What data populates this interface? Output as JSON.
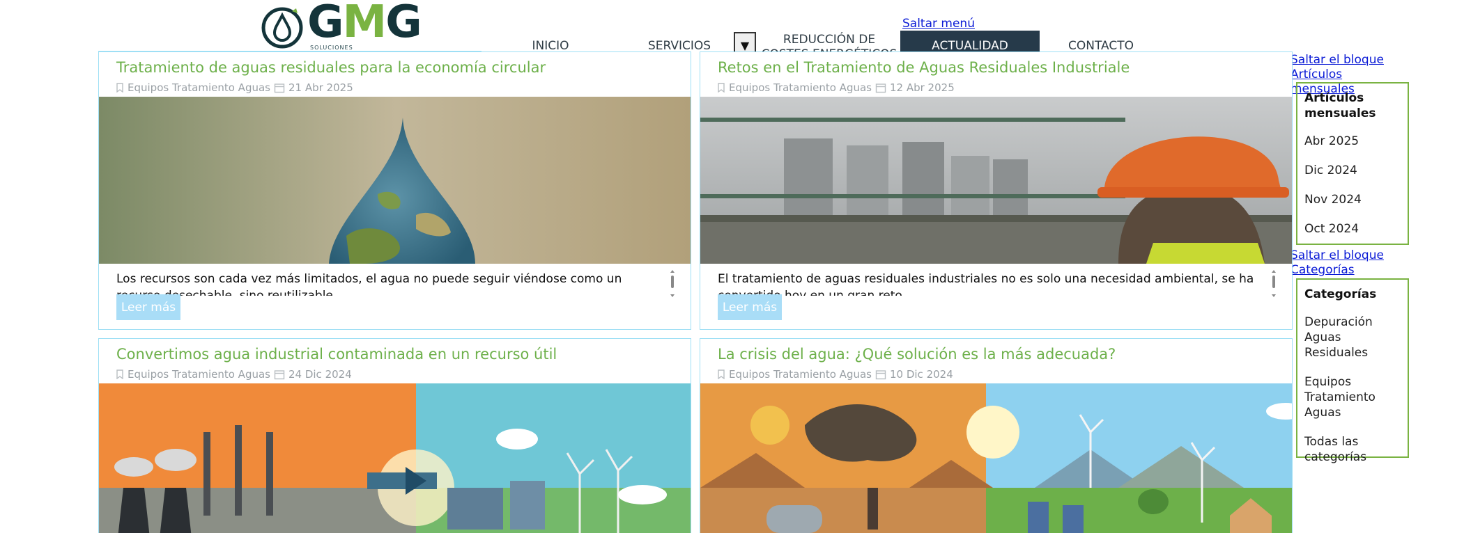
{
  "logo": {
    "text_a": "G",
    "text_b": "M",
    "text_c": "G",
    "subtitle": "SOLUCIONES MEDIOAMBIENTALES"
  },
  "skip_menu": "Saltar menú",
  "nav": {
    "inicio": "INICIO",
    "servicios": "SERVICIOS",
    "toggle": "▼",
    "reduccion": "REDUCCIÓN DE COSTES ENERGÉTICOS",
    "actualidad": "ACTUALIDAD",
    "contacto": "CONTACTO"
  },
  "sidebar": {
    "skip_monthly": "Saltar el bloque Artículos mensuales",
    "monthly": {
      "title": "Artículos mensuales",
      "items": [
        "Abr 2025",
        "Dic 2024",
        "Nov 2024",
        "Oct 2024"
      ]
    },
    "skip_categories": "Saltar el bloque Categorías",
    "categories": {
      "title": "Categorías",
      "items": [
        "Depuración Aguas Residuales",
        "Equipos Tratamiento Aguas",
        "Todas las categorías"
      ]
    }
  },
  "posts": [
    {
      "title": "Tratamiento de aguas residuales para la economía circular",
      "category": "Equipos Tratamiento Aguas",
      "date": "21 Abr 2025",
      "excerpt": "Los recursos son cada vez más limitados, el agua no puede seguir viéndose como un recurso desechable, sino reutilizable.",
      "read_more": "Leer más"
    },
    {
      "title": "Retos en el Tratamiento de Aguas Residuales Industriale",
      "category": "Equipos Tratamiento Aguas",
      "date": "12 Abr 2025",
      "excerpt": "El tratamiento de aguas residuales industriales no es solo una necesidad ambiental, se ha convertido hoy en un gran reto.",
      "read_more": "Leer más"
    },
    {
      "title": "Convertimos agua industrial contaminada en un recurso útil",
      "category": "Equipos Tratamiento Aguas",
      "date": "24 Dic 2024"
    },
    {
      "title": "La crisis del agua: ¿Qué solución es la más adecuada?",
      "category": "Equipos Tratamiento Aguas",
      "date": "10 Dic 2024"
    }
  ],
  "colors": {
    "accent_green": "#6db04a",
    "nav_active": "#263a4a",
    "card_border": "#9edff5",
    "button": "#a9ddf7",
    "link": "#0b1bd6"
  }
}
